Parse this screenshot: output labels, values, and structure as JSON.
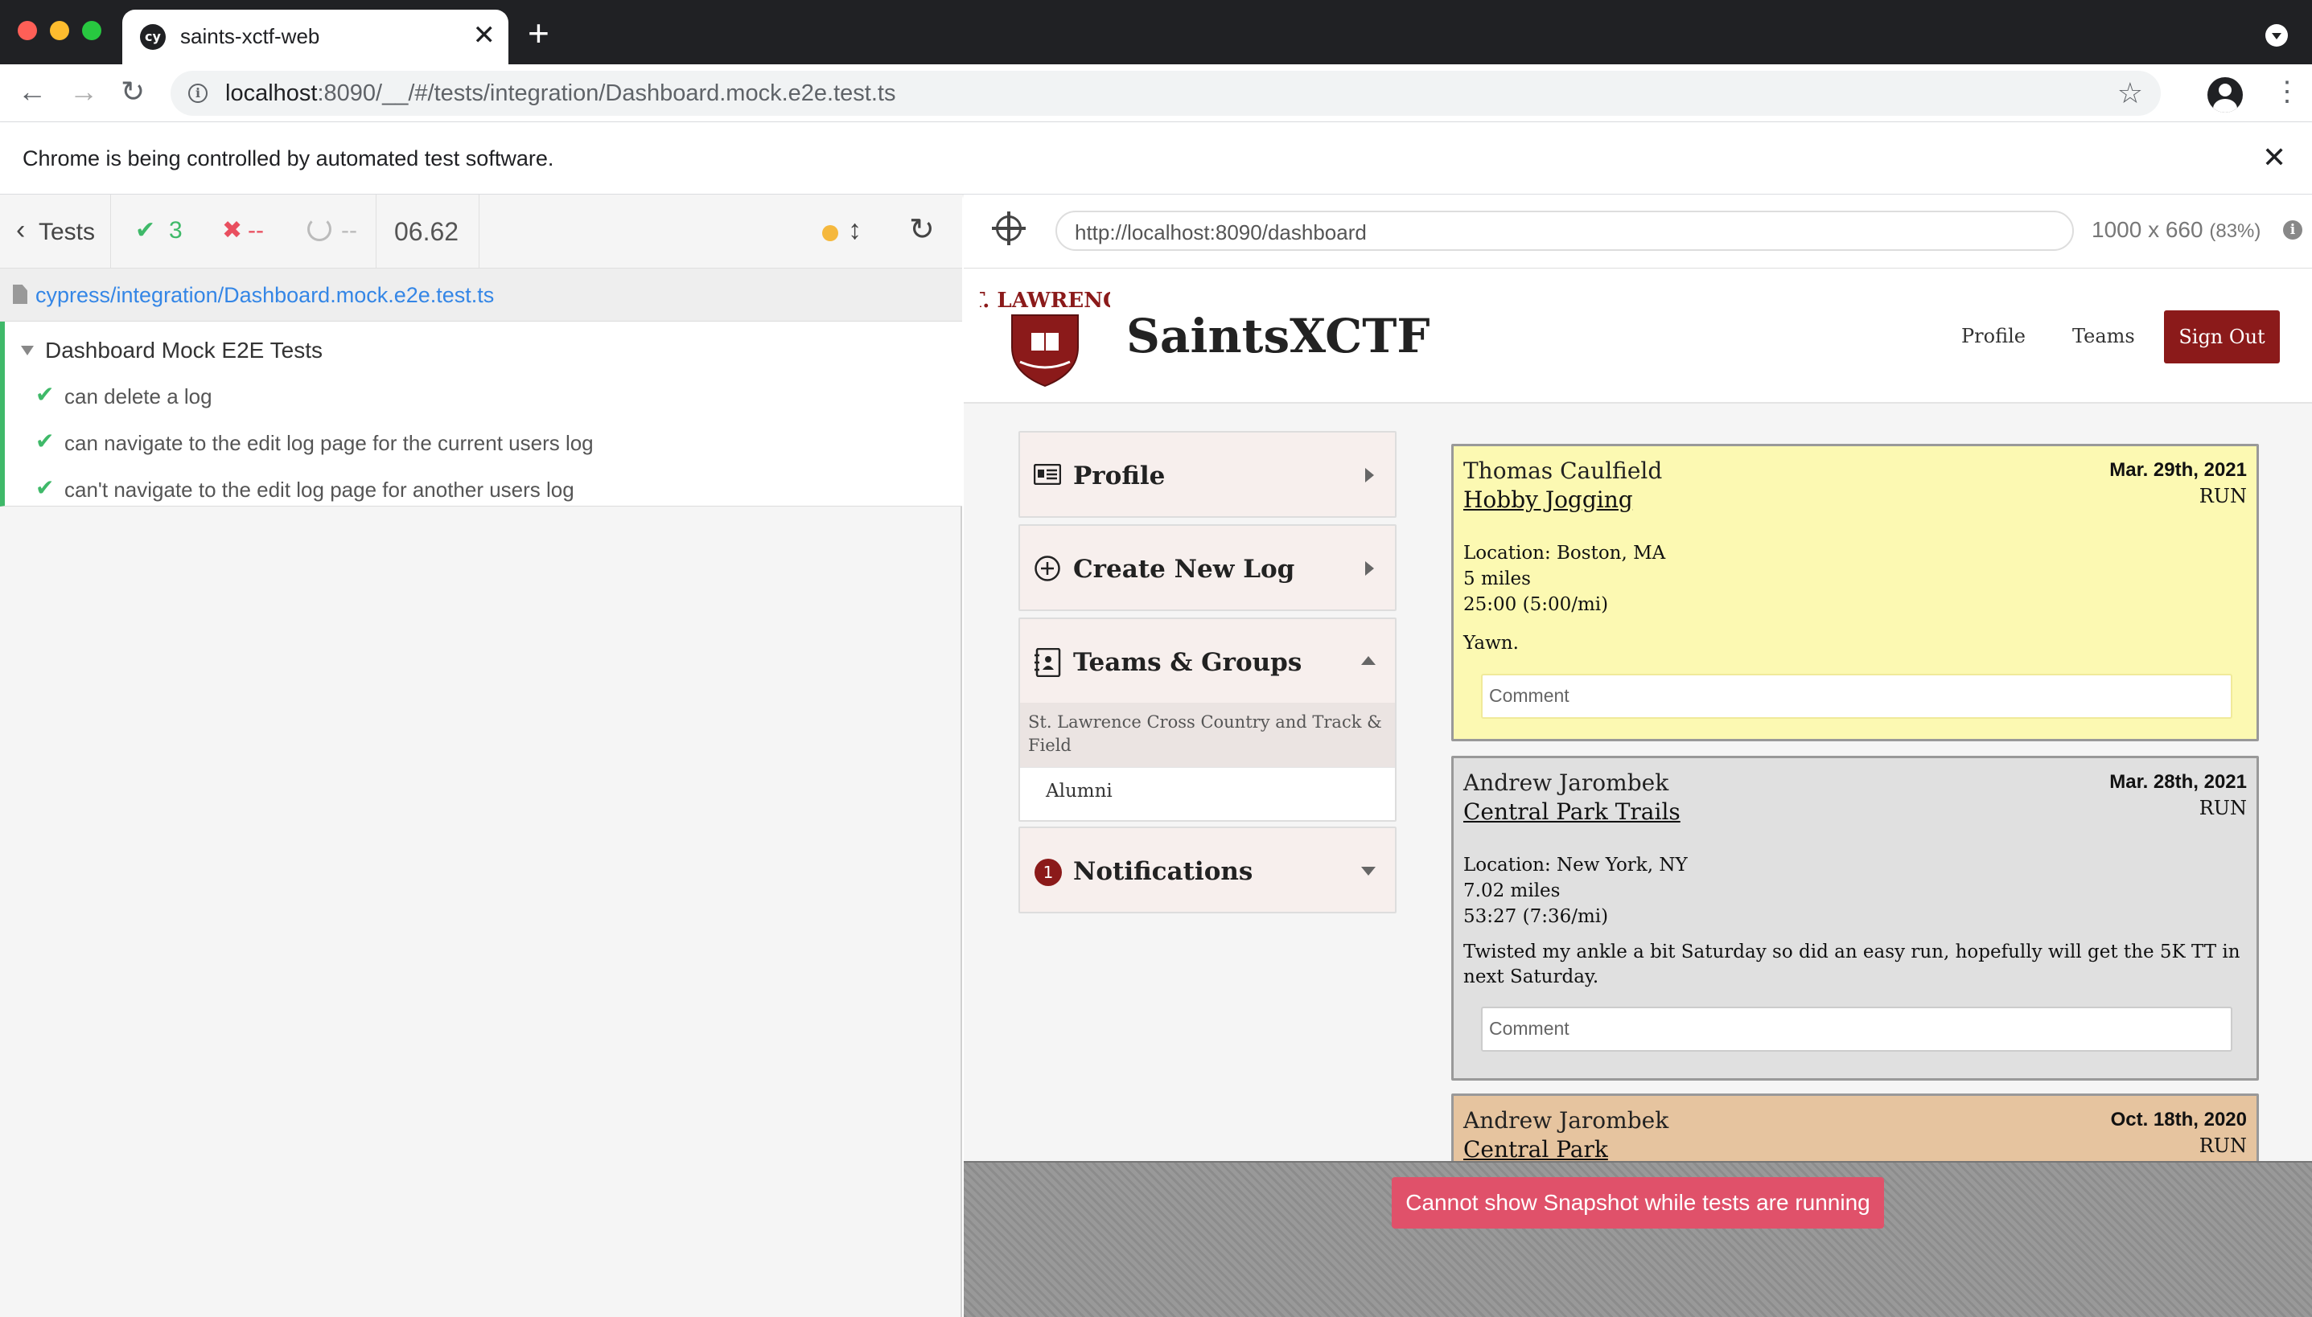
{
  "browser": {
    "tab_title": "saints-xctf-web",
    "tab_favicon": "cy",
    "tab_close": "✕",
    "new_tab": "+",
    "url_host": "localhost",
    "url_rest": ":8090/__/#/tests/integration/Dashboard.mock.e2e.test.ts",
    "infobar_text": "Chrome is being controlled by automated test software.",
    "infobar_close": "✕",
    "back_icon": "←",
    "forward_icon": "→",
    "reload_icon": "↻",
    "star_icon": "☆",
    "menu_icon": "⋮",
    "traffic_colors": [
      "#ff5f57",
      "#febc2e",
      "#28c840"
    ]
  },
  "reporter": {
    "tests_label": "Tests",
    "passed_count": "3",
    "failed_count": "--",
    "pending_count": "--",
    "duration": "06.62",
    "spec_path": "cypress/integration/Dashboard.mock.e2e.test.ts",
    "suite_title": "Dashboard Mock E2E Tests",
    "tests": [
      {
        "title": "can delete a log",
        "state": "passed"
      },
      {
        "title": "can navigate to the edit log page for the current users log",
        "state": "passed"
      },
      {
        "title": "can't navigate to the edit log page for another users log",
        "state": "passed"
      }
    ],
    "colors": {
      "passed": "#3fb969",
      "failed": "#e94f5f",
      "running": "#f5b83d",
      "link": "#3486e6"
    }
  },
  "aut": {
    "url": "http://localhost:8090/dashboard",
    "viewport": "1000 x 660",
    "scale": "(83%)",
    "snapshot_message": "Cannot show Snapshot while tests are running"
  },
  "app": {
    "title": "SaintsXCTF",
    "logo_text": "ST. LAWRENCE",
    "nav": {
      "profile": "Profile",
      "teams": "Teams",
      "sign_out": "Sign Out"
    },
    "brand_color": "#8b1a1a",
    "sidebar": {
      "profile": "Profile",
      "create_log": "Create New Log",
      "teams_groups": "Teams & Groups",
      "team_name": "St. Lawrence Cross Country and Track & Field",
      "group_name": "Alumni",
      "notifications": "Notifications",
      "notification_count": "1"
    },
    "logs": [
      {
        "user": "Thomas Caulfield",
        "title": "Hobby Jogging",
        "date": "Mar. 29th, 2021",
        "type": "RUN",
        "location": "Location: Boston, MA",
        "distance": "5 miles",
        "time": "25:00 (5:00/mi)",
        "description": "Yawn.",
        "comment_placeholder": "Comment",
        "bg": "#fcf9b2"
      },
      {
        "user": "Andrew Jarombek",
        "title": "Central Park Trails",
        "date": "Mar. 28th, 2021",
        "type": "RUN",
        "location": "Location: New York, NY",
        "distance": "7.02 miles",
        "time": "53:27 (7:36/mi)",
        "description": "Twisted my ankle a bit Saturday so did an easy run, hopefully will get the 5K TT in next Saturday.",
        "comment_placeholder": "Comment",
        "bg": "#e0e0e0"
      },
      {
        "user": "Andrew Jarombek",
        "title": "Central Park",
        "date": "Oct. 18th, 2020",
        "type": "RUN",
        "bg": "#e6c49f"
      }
    ]
  }
}
